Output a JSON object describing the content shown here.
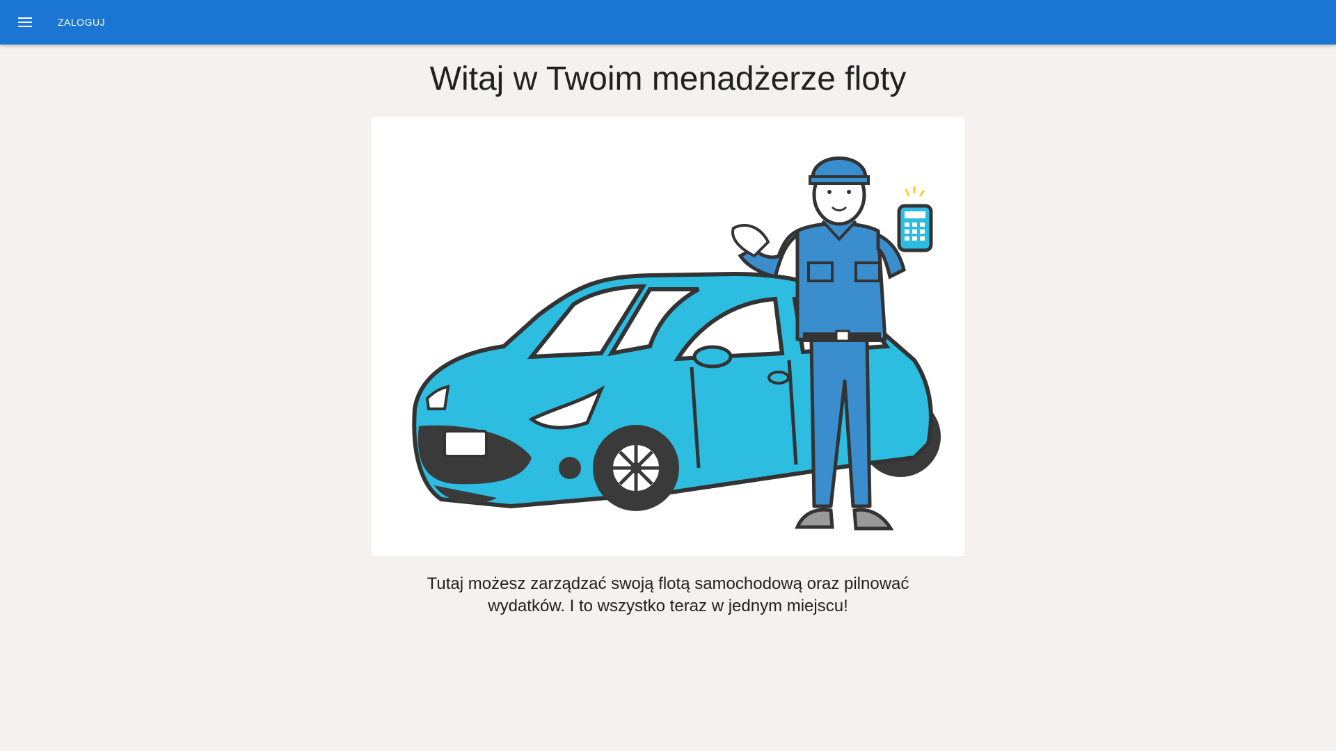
{
  "toolbar": {
    "menu_icon": "hamburger-menu-icon",
    "login_label": "ZALOGUJ",
    "background_color": "#1a76d2"
  },
  "main": {
    "title": "Witaj w Twoim menadżerze floty",
    "hero_image": "car-and-mechanic-illustration",
    "description": "Tutaj możesz zarządzać swoją flotą samochodową oraz pilnować wydatków. I to wszystko teraz w jednym miejscu!"
  },
  "colors": {
    "page_background": "#f5f1ef",
    "car_blue": "#2cbde0",
    "uniform_blue": "#3a8ece",
    "outline": "#333333"
  }
}
